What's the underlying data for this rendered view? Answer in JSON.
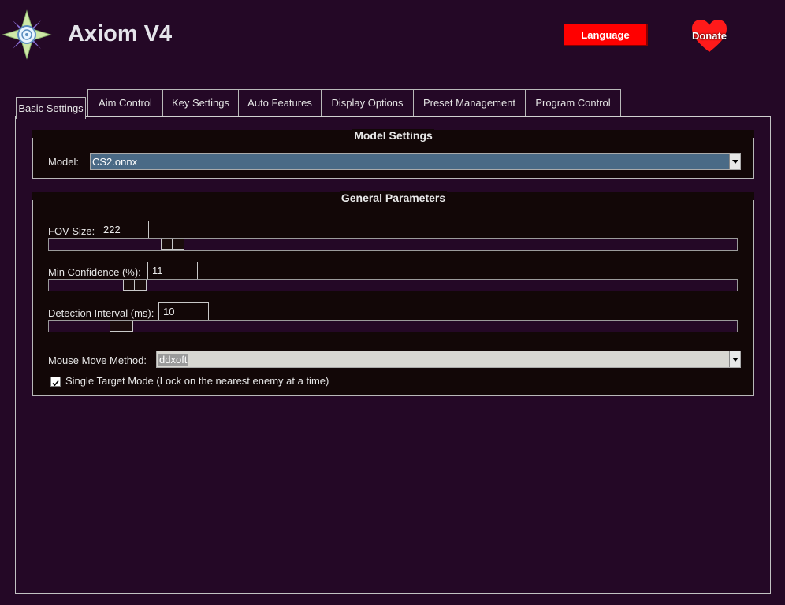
{
  "app": {
    "title": "Axiom V4",
    "logo_icon": "compass-star-icon"
  },
  "header": {
    "language_label": "Language",
    "donate_label": "Donate",
    "language_color": "#ff0000",
    "donate_icon": "heart-icon"
  },
  "tabs": [
    {
      "label": "Basic Settings",
      "active": true
    },
    {
      "label": "Aim Control",
      "active": false
    },
    {
      "label": "Key Settings",
      "active": false
    },
    {
      "label": "Auto Features",
      "active": false
    },
    {
      "label": "Display Options",
      "active": false
    },
    {
      "label": "Preset Management",
      "active": false
    },
    {
      "label": "Program Control",
      "active": false
    }
  ],
  "model_settings": {
    "title": "Model Settings",
    "model_label": "Model:",
    "model_value": "CS2.onnx"
  },
  "general": {
    "title": "General Parameters",
    "fov_label": "FOV Size:",
    "fov_value": "222",
    "min_conf_label": "Min Confidence (%):",
    "min_conf_value": "11",
    "interval_label": "Detection Interval (ms):",
    "interval_value": "10",
    "mouse_label": "Mouse Move Method:",
    "mouse_value": "ddxoft",
    "single_target_label": "Single Target Mode (Lock on the nearest enemy at a time)",
    "single_target_checked": true
  }
}
